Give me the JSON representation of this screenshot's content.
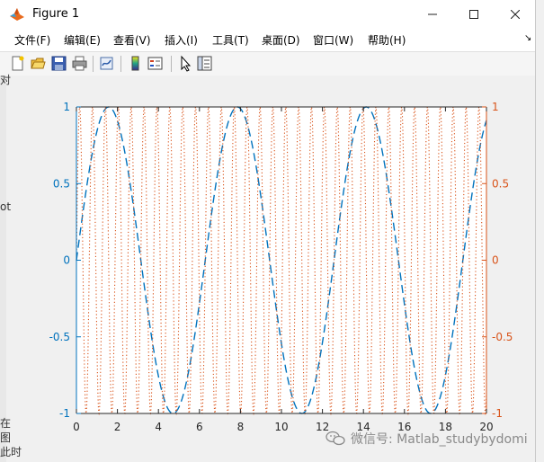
{
  "window": {
    "title": "Figure 1"
  },
  "menu": [
    "文件(F)",
    "编辑(E)",
    "查看(V)",
    "插入(I)",
    "工具(T)",
    "桌面(D)",
    "窗口(W)",
    "帮助(H)"
  ],
  "toolbar_icons": [
    "new-figure-icon",
    "open-file-icon",
    "save-icon",
    "print-icon",
    "link-plot-icon",
    "colorbar-icon",
    "legend-icon",
    "pointer-icon",
    "property-editor-icon"
  ],
  "colors": {
    "left_axis": "#0072BD",
    "right_axis": "#D95319",
    "plot_bg": "#ffffff"
  },
  "chart_data": {
    "type": "line",
    "title": "",
    "xlabel": "",
    "ylabel": "",
    "xlim": [
      0,
      20
    ],
    "xticks": [
      0,
      2,
      4,
      6,
      8,
      10,
      12,
      14,
      16,
      18,
      20
    ],
    "y_left": {
      "lim": [
        -1,
        1
      ],
      "ticks": [
        "1",
        "0.5",
        "0",
        "-0.5",
        "-1"
      ]
    },
    "y_right": {
      "lim": [
        -1,
        1
      ],
      "ticks": [
        "1",
        "0.5",
        "0",
        "-0.5",
        "-1"
      ]
    },
    "series": [
      {
        "axis": "left",
        "function": "sin(x)",
        "style": "dashed",
        "color": "#0072BD"
      },
      {
        "axis": "right",
        "function": "sin(10x)",
        "style": "dotted",
        "color": "#D95319"
      }
    ],
    "grid": false
  },
  "watermark": {
    "text": "微信号: Matlab_studybydomi"
  },
  "background_fragments": [
    "对",
    "ot",
    "在",
    "图",
    "此时"
  ]
}
